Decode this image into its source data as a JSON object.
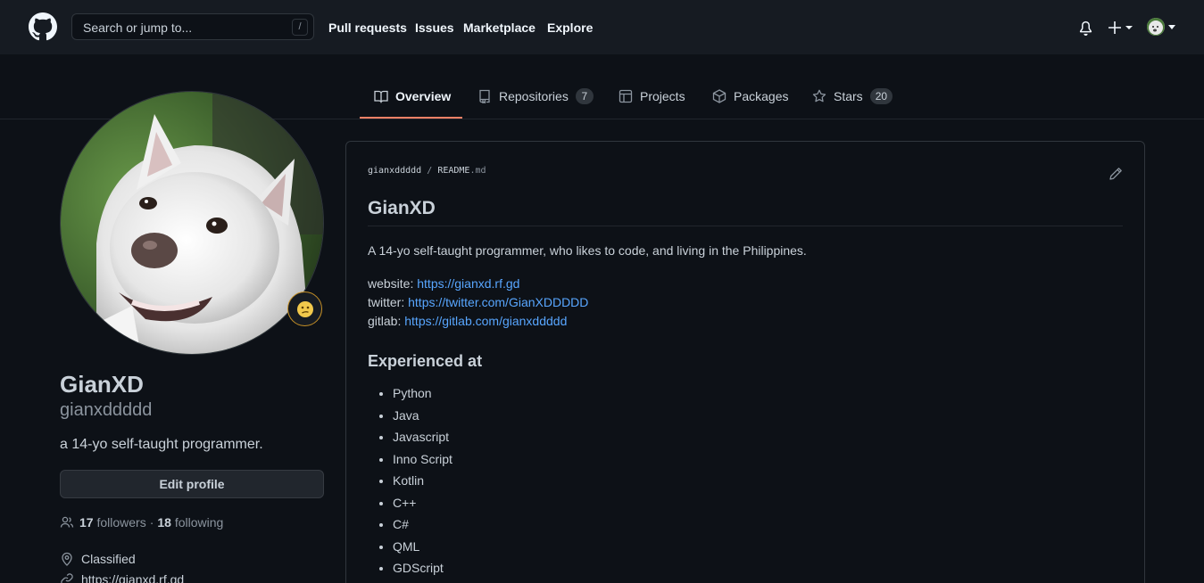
{
  "header": {
    "search_placeholder": "Search or jump to...",
    "search_shortcut": "/",
    "nav": [
      "Pull requests",
      "Issues",
      "Marketplace",
      "Explore"
    ],
    "plus_label": "+"
  },
  "tabs": [
    {
      "label": "Overview",
      "icon": "book-icon",
      "active": true
    },
    {
      "label": "Repositories",
      "icon": "repo-icon",
      "count": "7"
    },
    {
      "label": "Projects",
      "icon": "project-icon"
    },
    {
      "label": "Packages",
      "icon": "package-icon"
    },
    {
      "label": "Stars",
      "icon": "star-icon",
      "count": "20"
    }
  ],
  "profile": {
    "fullname": "GianXD",
    "username": "gianxddddd",
    "bio": "a 14-yo self-taught programmer.",
    "edit_label": "Edit profile",
    "followers_count": "17",
    "followers_label": "followers",
    "separator": "·",
    "following_count": "18",
    "following_label": "following",
    "location": "Classified",
    "website": "https://gianxd.rf.gd",
    "status_emoji": "😕"
  },
  "readme": {
    "owner": "gianxddddd",
    "sep": "/",
    "file_name": "README",
    "file_ext": ".md",
    "title": "GianXD",
    "intro": "A 14-yo self-taught programmer, who likes to code, and living in the Philippines.",
    "links": [
      {
        "label": "website:",
        "url": "https://gianxd.rf.gd"
      },
      {
        "label": "twitter:",
        "url": "https://twitter.com/GianXDDDDD"
      },
      {
        "label": "gitlab:",
        "url": "https://gitlab.com/gianxddddd"
      }
    ],
    "section_title": "Experienced at",
    "skills": [
      "Python",
      "Java",
      "Javascript",
      "Inno Script",
      "Kotlin",
      "C++",
      "C#",
      "QML",
      "GDScript"
    ]
  },
  "colors": {
    "background": "#0d1117",
    "header": "#161b22",
    "link": "#58a6ff",
    "tab_active": "#f78166"
  }
}
